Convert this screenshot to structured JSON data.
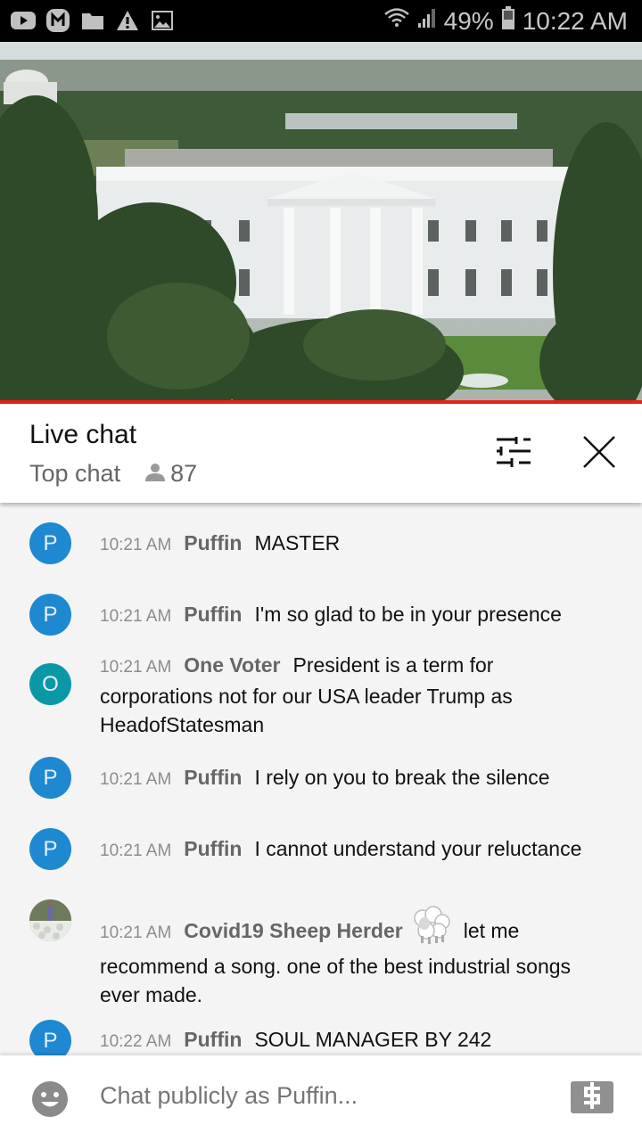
{
  "status_bar": {
    "notification_icons": [
      "youtube-icon",
      "m-app-icon",
      "folder-icon",
      "warning-icon",
      "image-icon"
    ],
    "battery": "49%",
    "time": "10:22 AM"
  },
  "video": {
    "description": "Live camera view of the White House north facade",
    "accent_color": "#e62117"
  },
  "chat_header": {
    "title": "Live chat",
    "mode": "Top chat",
    "viewer_count": "87"
  },
  "messages": [
    {
      "avatar_letter": "P",
      "avatar_color": "#1e88d0",
      "time": "10:21 AM",
      "author": "Puffin",
      "text": "MASTER"
    },
    {
      "avatar_letter": "P",
      "avatar_color": "#1e88d0",
      "time": "10:21 AM",
      "author": "Puffin",
      "text": "I'm so glad to be in your presence"
    },
    {
      "avatar_letter": "O",
      "avatar_color": "#0b98a6",
      "time": "10:21 AM",
      "author": "One Voter",
      "text": "President is a term for corporations not for our USA leader Trump as HeadofStatesman"
    },
    {
      "avatar_letter": "P",
      "avatar_color": "#1e88d0",
      "time": "10:21 AM",
      "author": "Puffin",
      "text": "I rely on you to break the silence"
    },
    {
      "avatar_letter": "P",
      "avatar_color": "#1e88d0",
      "time": "10:21 AM",
      "author": "Puffin",
      "text": "I cannot understand your reluctance"
    },
    {
      "avatar_letter": "",
      "avatar_color": "#7c8a6e",
      "time": "10:21 AM",
      "author": "Covid19 Sheep Herder",
      "badge": "sheep-icon",
      "text": "let me recommend a song. one of the best industrial songs ever made."
    },
    {
      "avatar_letter": "P",
      "avatar_color": "#1e88d0",
      "time": "10:22 AM",
      "author": "Puffin",
      "text": "SOUL MANAGER BY 242"
    }
  ],
  "composer": {
    "placeholder": "Chat publicly as Puffin..."
  }
}
